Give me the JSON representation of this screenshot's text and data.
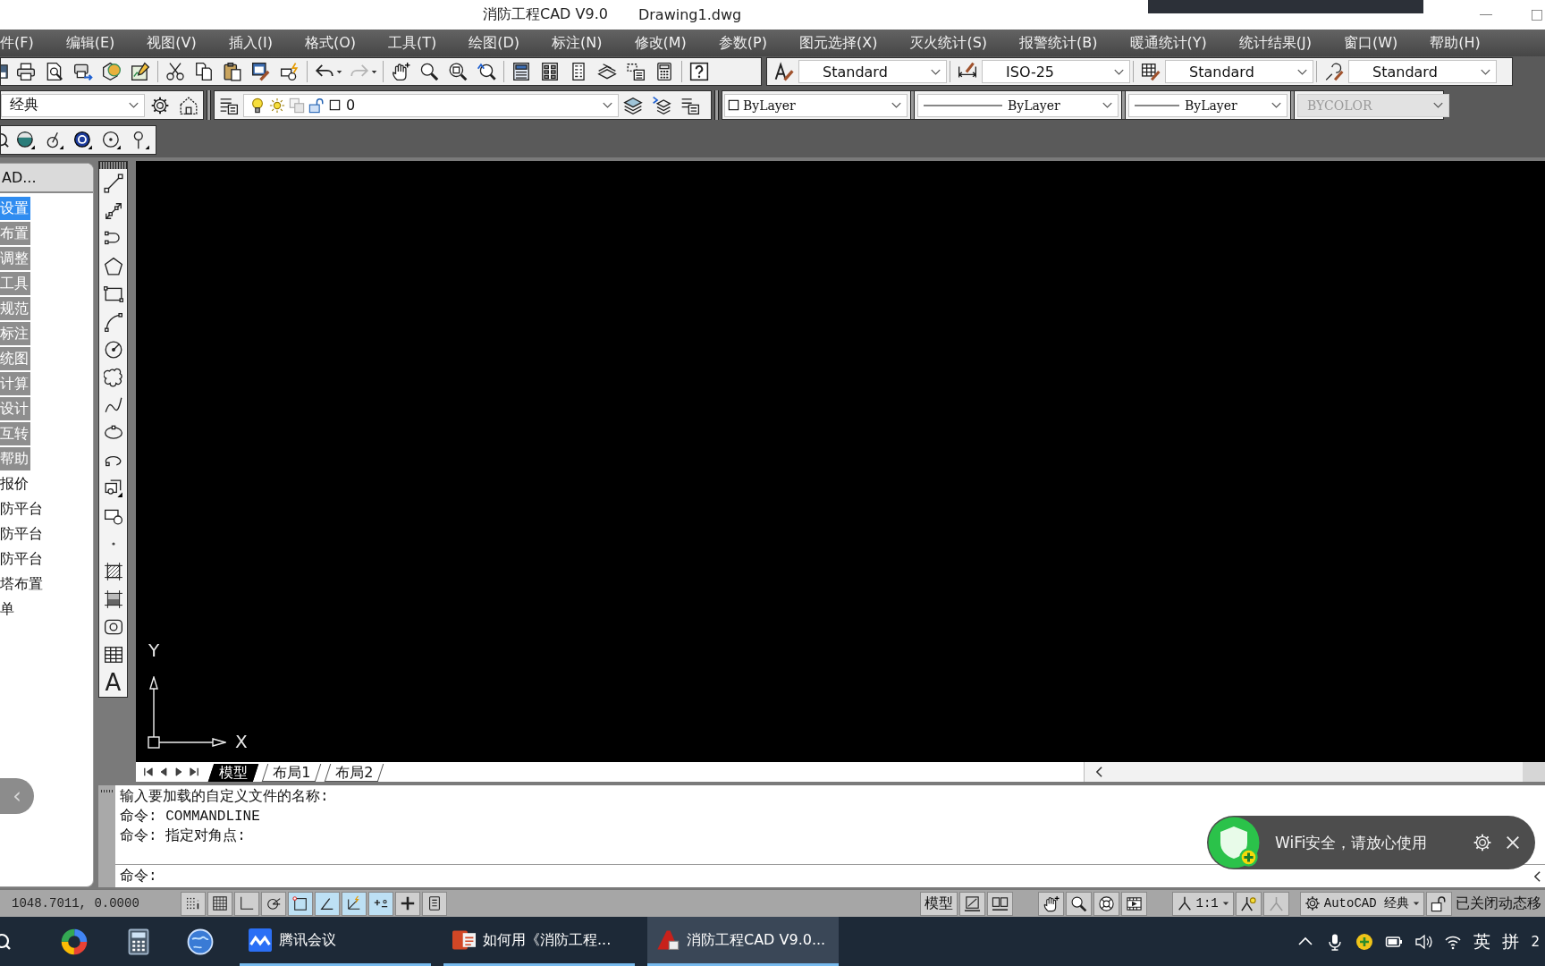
{
  "window": {
    "title": "消防工程CAD V9.0",
    "document": "Drawing1.dwg"
  },
  "menu": [
    "件(F)",
    "编辑(E)",
    "视图(V)",
    "插入(I)",
    "格式(O)",
    "工具(T)",
    "绘图(D)",
    "标注(N)",
    "修改(M)",
    "参数(P)",
    "图元选择(X)",
    "灭火统计(S)",
    "报警统计(B)",
    "暖通统计(Y)",
    "统计结果(J)",
    "窗口(W)",
    "帮助(H)"
  ],
  "style_toolbar": [
    {
      "kind": "text",
      "value": "Standard"
    },
    {
      "kind": "dimension",
      "value": "ISO-25"
    },
    {
      "kind": "table",
      "value": "Standard"
    },
    {
      "kind": "multileader",
      "value": "Standard"
    }
  ],
  "workspace_toolbar": {
    "value": "经典"
  },
  "layer_toolbar": {
    "current_layer": "0"
  },
  "properties_toolbar": [
    {
      "kind": "color",
      "value": "ByLayer",
      "disabled": false
    },
    {
      "kind": "linetype",
      "value": "ByLayer",
      "disabled": false
    },
    {
      "kind": "lineweight",
      "value": "ByLayer",
      "disabled": false
    },
    {
      "kind": "plotstyle",
      "value": "BYCOLOR",
      "disabled": true
    }
  ],
  "side_panel": {
    "title": "AD...",
    "items": [
      {
        "label": "设置",
        "kind": "group",
        "selected": true
      },
      {
        "label": "布置",
        "kind": "group",
        "selected": false
      },
      {
        "label": "调整",
        "kind": "group",
        "selected": false
      },
      {
        "label": "工具",
        "kind": "group",
        "selected": false
      },
      {
        "label": "规范",
        "kind": "group",
        "selected": false
      },
      {
        "label": "标注",
        "kind": "group",
        "selected": false
      },
      {
        "label": "统图",
        "kind": "group",
        "selected": false
      },
      {
        "label": "计算",
        "kind": "group",
        "selected": false
      },
      {
        "label": "设计",
        "kind": "group",
        "selected": false
      },
      {
        "label": "互转",
        "kind": "group",
        "selected": false
      },
      {
        "label": "帮助",
        "kind": "group",
        "selected": false
      },
      {
        "label": "报价",
        "kind": "link",
        "selected": false
      },
      {
        "label": "防平台",
        "kind": "link",
        "selected": false
      },
      {
        "label": "防平台",
        "kind": "link",
        "selected": false
      },
      {
        "label": "防平台",
        "kind": "link",
        "selected": false
      },
      {
        "label": "塔布置",
        "kind": "link",
        "selected": false
      },
      {
        "label": "单",
        "kind": "link",
        "selected": false
      }
    ],
    "collapse_button": "‹"
  },
  "draw_toolbar": {
    "text_tool": "A"
  },
  "canvas": {
    "ucs": {
      "y_label": "Y",
      "x_label": "X"
    }
  },
  "layout_tabs": [
    {
      "label": "模型",
      "selected": true
    },
    {
      "label": "布局1",
      "selected": false
    },
    {
      "label": "布局2",
      "selected": false
    }
  ],
  "command_window": {
    "history": [
      "输入要加载的自定义文件的名称:",
      "命令: COMMANDLINE",
      "命令: 指定对角点:"
    ],
    "prompt": "命令:"
  },
  "notification": {
    "message": "WiFi安全，请放心使用"
  },
  "status_bar": {
    "coordinates": "1048.7011, 0.0000",
    "toggles": [
      {
        "kind": "snap",
        "on": false
      },
      {
        "kind": "grid",
        "on": false
      },
      {
        "kind": "ortho",
        "on": false
      },
      {
        "kind": "polar",
        "on": false
      },
      {
        "kind": "osnap",
        "on": true
      },
      {
        "kind": "otrack",
        "on": true
      },
      {
        "kind": "ducs",
        "on": true
      },
      {
        "kind": "dyn",
        "on": true
      },
      {
        "kind": "lwt",
        "on": false
      },
      {
        "kind": "qp",
        "on": false
      }
    ],
    "model_button": "模型",
    "annotation_scale": "1:1",
    "workspace": "AutoCAD 经典",
    "message": "已关闭动态移"
  },
  "taskbar": {
    "apps": [
      {
        "kind": "meeting",
        "label": "腾讯会议",
        "active": false
      },
      {
        "kind": "slides",
        "label": "如何用《消防工程...",
        "active": false
      },
      {
        "kind": "cad",
        "label": "消防工程CAD V9.0...",
        "active": true
      }
    ],
    "input_language": "英",
    "input_mode": "拼",
    "clock": "2"
  }
}
